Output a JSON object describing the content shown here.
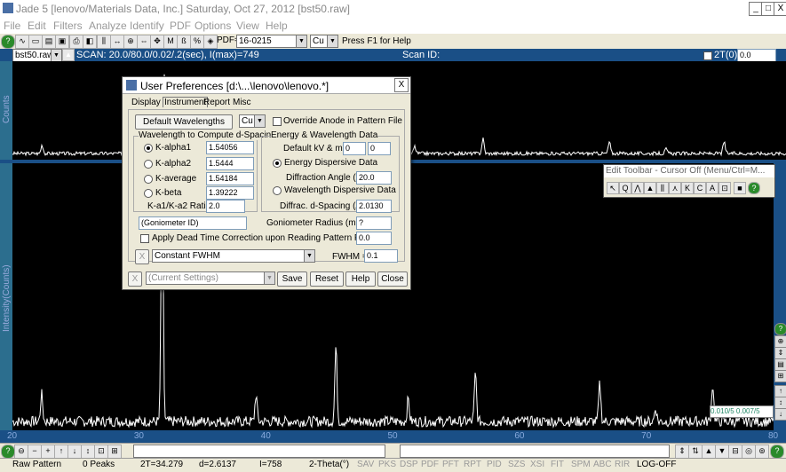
{
  "window": {
    "title": "Jade 5 [lenovo/Materials Data, Inc.] Saturday, Oct 27, 2012 [bst50.raw]",
    "min": "_",
    "max": "□",
    "close": "X"
  },
  "menu": [
    "File",
    "Edit",
    "Filters",
    "Analyze",
    "Identify",
    "PDF",
    "Options",
    "View",
    "Help"
  ],
  "toolbar": {
    "pdf_label": "PDF=",
    "pdf_value": "16-0215",
    "anode": "Cu",
    "hint": "Press F1 for Help"
  },
  "scanbar": {
    "file": "bst50.raw",
    "scan": "SCAN: 20.0/80.0/0.02/.2(sec), I(max)=749",
    "scan_id_label": "Scan ID:",
    "two_theta_label": "2T(0)=",
    "two_theta_value": "0.0"
  },
  "axes": {
    "top_ylabel": "Counts",
    "main_ylabel": "Intensity(Counts)",
    "x_ticks": [
      "20",
      "30",
      "40",
      "50",
      "60",
      "70",
      "80"
    ]
  },
  "readout": "0.010/5 0.007/5",
  "dialog": {
    "title": "User Preferences [d:\\...\\lenovo\\lenovo.*]",
    "tabs": [
      "Display",
      "Instrument",
      "Report",
      "Misc"
    ],
    "default_wavelengths_btn": "Default Wavelengths",
    "anode": "Cu",
    "override_label": "Override Anode in Pattern File",
    "wavelength_group": "Wavelength to Compute d-Spacing",
    "wavelengths": [
      {
        "label": "K-alpha1",
        "value": "1.54056",
        "selected": true
      },
      {
        "label": "K-alpha2",
        "value": "1.5444",
        "selected": false
      },
      {
        "label": "K-average",
        "value": "1.54184",
        "selected": false
      },
      {
        "label": "K-beta",
        "value": "1.39222",
        "selected": false
      }
    ],
    "ratio_label": "K-a1/K-a2 Ratio =",
    "ratio_value": "2.0",
    "energy_group": "Energy & Wavelength Data",
    "kv_label": "Default kV & mA =",
    "kv_value": "0",
    "ma_value": "0",
    "energy_dispersive": "Energy Dispersive Data",
    "diffraction_angle_label": "Diffraction Angle (°) =",
    "diffraction_angle_value": "20.0",
    "wavelength_dispersive": "Wavelength Dispersive Data",
    "d_spacing_label": "Diffrac. d-Spacing (A) =",
    "d_spacing_value": "2.0130",
    "goniometer_id": "(Goniometer ID)",
    "goniometer_radius_label": "Goniometer Radius (mm) =",
    "goniometer_radius_value": "?",
    "dead_time_label": "Apply Dead Time Correction upon Reading Pattern Files",
    "dead_time_value": "0.0",
    "fwhm_mode": "Constant FWHM",
    "fwhm_label": "FWHM =",
    "fwhm_value": "0.1",
    "settings": "(Current Settings)",
    "buttons": [
      "Save",
      "Reset",
      "Help",
      "Close"
    ],
    "x_mark": "X"
  },
  "edit_toolbar": {
    "title": "Edit Toolbar - Cursor Off (Menu/Ctrl=M..."
  },
  "status": {
    "pattern": "Raw Pattern",
    "peaks": "0 Peaks",
    "two_theta": "2T=34.279",
    "d": "d=2.6137",
    "intensity": "I=758",
    "mode": "2-Theta(°)",
    "flags": [
      "SAV",
      "PKS",
      "DSP",
      "PDF",
      "PFT",
      "RPT",
      "PID",
      "SZS",
      "XSI",
      "FIT",
      "SPM",
      "ABC",
      "RIR",
      "LOG-OFF"
    ]
  },
  "spectrum_peaks": [
    {
      "two_theta": 22.3,
      "intensity": 80
    },
    {
      "two_theta": 31.8,
      "intensity": 760
    },
    {
      "two_theta": 39.2,
      "intensity": 78
    },
    {
      "two_theta": 45.5,
      "intensity": 220
    },
    {
      "two_theta": 51.2,
      "intensity": 66
    },
    {
      "two_theta": 56.5,
      "intensity": 140
    },
    {
      "two_theta": 66.3,
      "intensity": 110
    },
    {
      "two_theta": 70.7,
      "intensity": 40
    },
    {
      "two_theta": 75.2,
      "intensity": 110
    }
  ]
}
